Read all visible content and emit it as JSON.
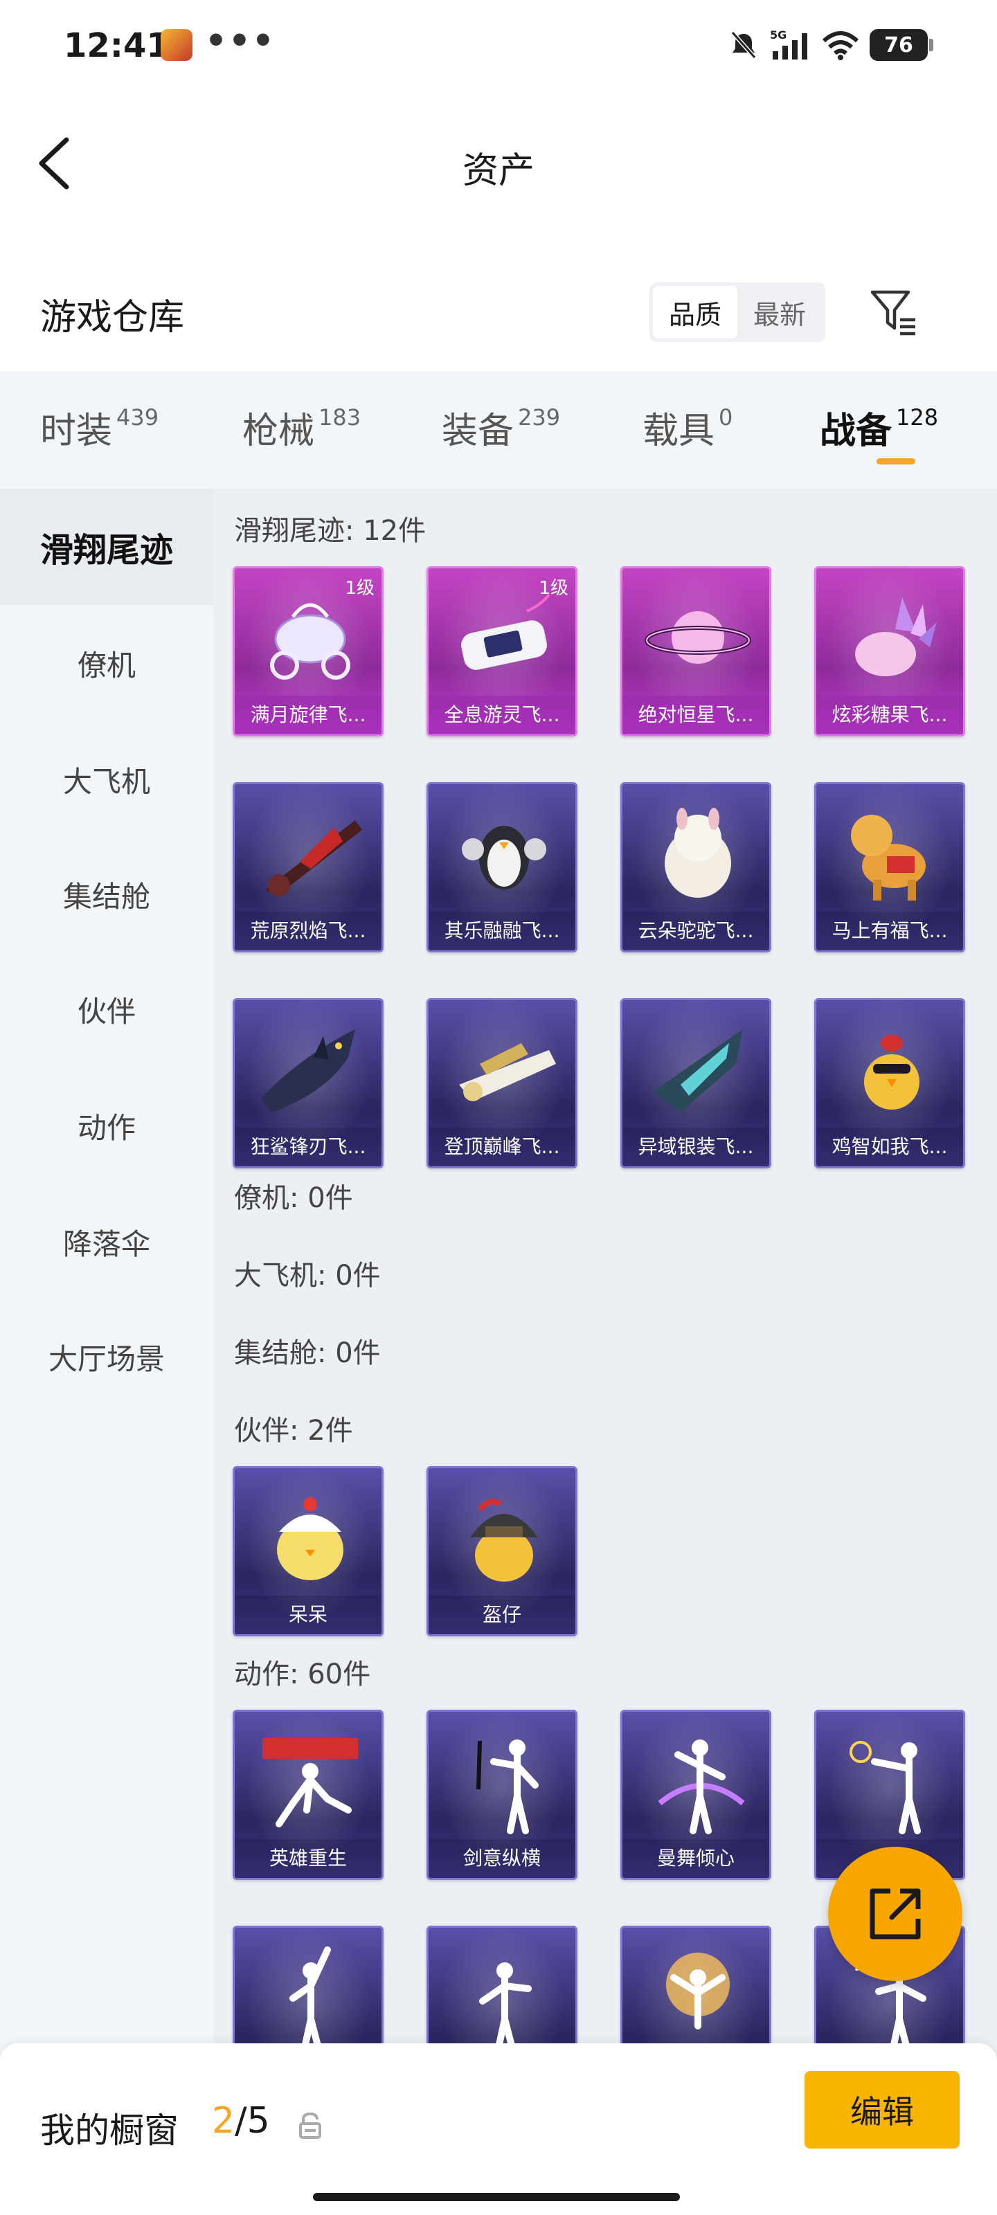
{
  "status_bar": {
    "time": "12:41",
    "dots": "•••",
    "battery": "76",
    "network": "5G"
  },
  "header": {
    "title": "资产"
  },
  "warehouse": {
    "title": "游戏仓库",
    "sort_options": [
      "品质",
      "最新"
    ],
    "active_sort": "品质"
  },
  "tabs": [
    {
      "label": "时装",
      "count": "439"
    },
    {
      "label": "枪械",
      "count": "183"
    },
    {
      "label": "装备",
      "count": "239"
    },
    {
      "label": "载具",
      "count": "0"
    },
    {
      "label": "战备",
      "count": "128"
    }
  ],
  "active_tab": "战备",
  "sidebar": {
    "items": [
      "滑翔尾迹",
      "僚机",
      "大飞机",
      "集结舱",
      "伙伴",
      "动作",
      "降落伞",
      "大厅场景"
    ],
    "active": "滑翔尾迹"
  },
  "sections": {
    "glide": {
      "title": "滑翔尾迹: 12件",
      "items": [
        {
          "name": "满月旋律飞...",
          "level": "1级",
          "rarity": "legend"
        },
        {
          "name": "全息游灵飞...",
          "level": "1级",
          "rarity": "legend"
        },
        {
          "name": "绝对恒星飞...",
          "level": "",
          "rarity": "legend"
        },
        {
          "name": "炫彩糖果飞...",
          "level": "",
          "rarity": "legend"
        },
        {
          "name": "荒原烈焰飞...",
          "level": "",
          "rarity": "epic"
        },
        {
          "name": "其乐融融飞...",
          "level": "",
          "rarity": "epic"
        },
        {
          "name": "云朵驼驼飞...",
          "level": "",
          "rarity": "epic"
        },
        {
          "name": "马上有福飞...",
          "level": "",
          "rarity": "epic"
        },
        {
          "name": "狂鲨锋刃飞...",
          "level": "",
          "rarity": "epic"
        },
        {
          "name": "登顶巅峰飞...",
          "level": "",
          "rarity": "epic"
        },
        {
          "name": "异域银装飞...",
          "level": "",
          "rarity": "epic"
        },
        {
          "name": "鸡智如我飞...",
          "level": "",
          "rarity": "epic"
        }
      ]
    },
    "wingman": {
      "title": "僚机: 0件"
    },
    "plane": {
      "title": "大飞机: 0件"
    },
    "pod": {
      "title": "集结舱: 0件"
    },
    "partner": {
      "title": "伙伴: 2件",
      "items": [
        {
          "name": "呆呆",
          "rarity": "epic"
        },
        {
          "name": "盔仔",
          "rarity": "epic"
        }
      ]
    },
    "emote": {
      "title": "动作: 60件",
      "items": [
        {
          "name": "英雄重生",
          "rarity": "epic"
        },
        {
          "name": "剑意纵横",
          "rarity": "epic"
        },
        {
          "name": "曼舞倾心",
          "rarity": "epic"
        },
        {
          "name": "",
          "rarity": "epic"
        },
        {
          "name": "",
          "rarity": "epic"
        },
        {
          "name": "",
          "rarity": "epic"
        },
        {
          "name": "",
          "rarity": "epic"
        },
        {
          "name": "",
          "rarity": "epic"
        }
      ]
    }
  },
  "bottom_bar": {
    "showcase_label": "我的橱窗",
    "showcase_current": "2",
    "showcase_total": "/5",
    "edit_label": "编辑"
  },
  "colors": {
    "accent": "#f5a623",
    "legend": "#b93ec4",
    "epic": "#3b3482"
  }
}
